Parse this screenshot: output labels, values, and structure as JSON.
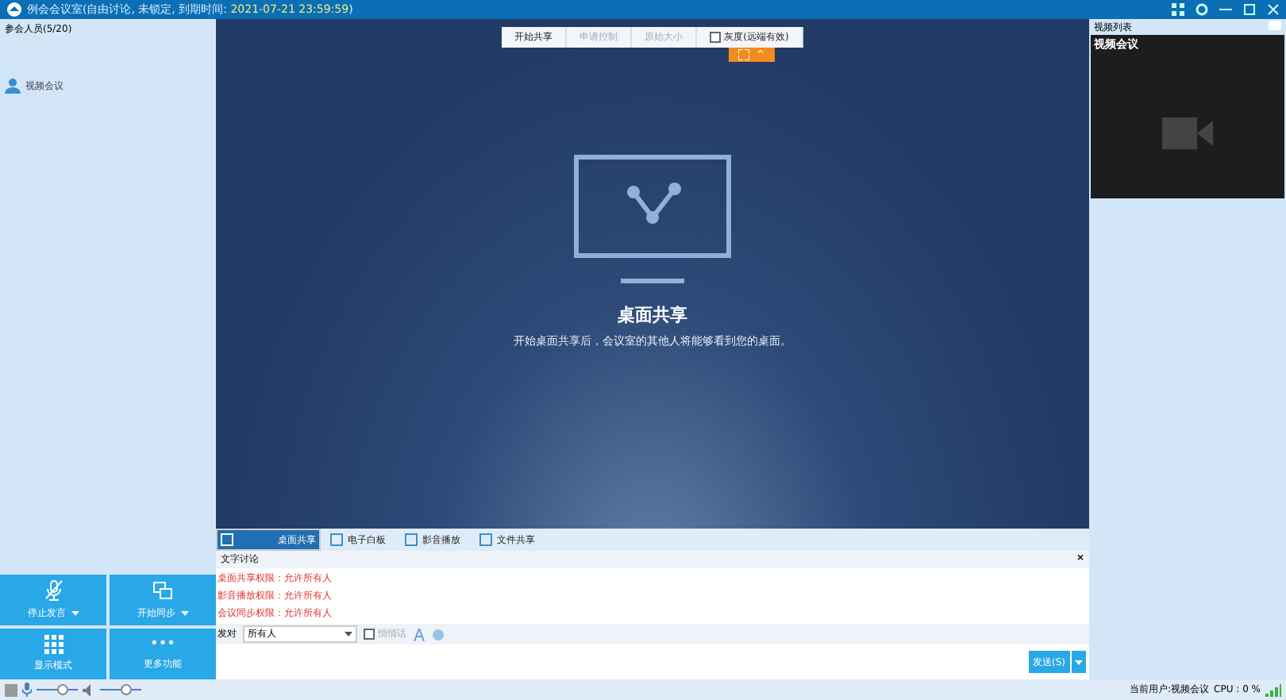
{
  "title_bar": {
    "title": "例会会议室(自由讨论, 未锁定, 到期时间: ",
    "expiry": "2021-07-21 23:59:59",
    "title_end": ")"
  },
  "participants": {
    "header": "参会人员(5/20)",
    "users": [
      {
        "name": "视频会议"
      }
    ]
  },
  "actions": [
    {
      "kind": "mic",
      "label": "停止发言",
      "has_menu": true
    },
    {
      "kind": "sync",
      "label": "开始同步",
      "has_menu": true
    },
    {
      "kind": "grid",
      "label": "显示模式",
      "has_menu": false
    },
    {
      "kind": "more",
      "icon": "•••",
      "label": "更多功能",
      "has_menu": false
    }
  ],
  "audio": {
    "mic": {
      "level": 0.6
    },
    "speaker": {
      "level": 0.6
    }
  },
  "toolbar": {
    "buttons": [
      {
        "label": "开始共享",
        "disabled": false
      },
      {
        "label": "申请控制",
        "disabled": true
      },
      {
        "label": "原始大小",
        "disabled": true
      }
    ],
    "grayscale": {
      "label": "灰度(远端有效)",
      "checked": false
    },
    "collapse_caret": "^"
  },
  "share": {
    "title": "桌面共享",
    "subtitle": "开始桌面共享后，会议室的其他人将能够看到您的桌面。"
  },
  "tabs": [
    {
      "label": "桌面共享",
      "selected": true
    },
    {
      "label": "电子白板",
      "selected": false
    },
    {
      "label": "影音播放",
      "selected": false
    },
    {
      "label": "文件共享",
      "selected": false
    }
  ],
  "chat": {
    "header": "文字讨论",
    "close": "×",
    "messages": [
      "桌面共享权限：允许所有人",
      "影音播放权限：允许所有人",
      "会议同步权限：允许所有人"
    ],
    "to_label": "发对",
    "recipient": "所有人",
    "whisper": {
      "label": "悄悄话",
      "checked": false,
      "disabled": true
    },
    "send": "发送(S)"
  },
  "video": {
    "header": "视频列表",
    "title": "视频会议"
  },
  "status": {
    "user": "当前用户:视频会议",
    "cpu": "CPU : 0 %"
  }
}
